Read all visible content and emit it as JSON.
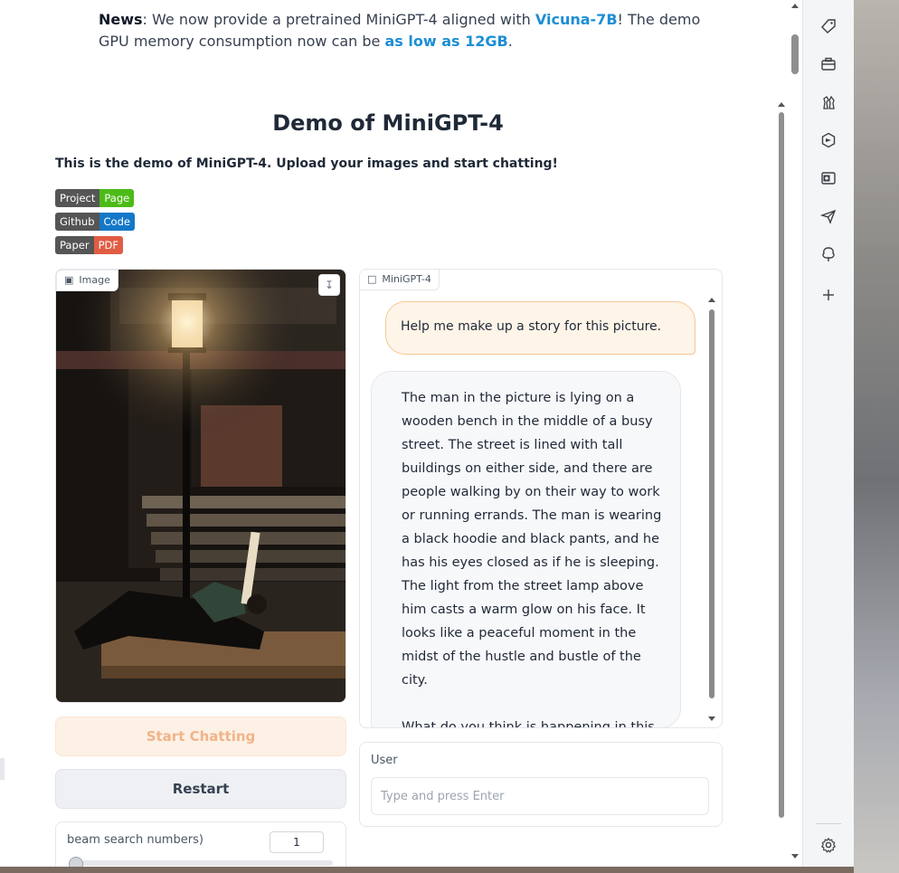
{
  "news": {
    "label": "News",
    "part1": ": We now provide a pretrained MiniGPT-4 aligned with ",
    "link1": "Vicuna-7B",
    "part2": "! The demo GPU memory consumption now can be ",
    "link2": "as low as 12GB",
    "part3": "."
  },
  "title": "Demo of MiniGPT-4",
  "subtitle": "This is the demo of MiniGPT-4. Upload your images and start chatting!",
  "badges": [
    {
      "left": "Project",
      "right": "Page"
    },
    {
      "left": "Github",
      "right": "Code"
    },
    {
      "left": "Paper",
      "right": "PDF"
    }
  ],
  "image_panel": {
    "label": "Image"
  },
  "buttons": {
    "start": "Start Chatting",
    "restart": "Restart"
  },
  "beam": {
    "label": "beam search numbers)",
    "value": "1"
  },
  "chat": {
    "label": "MiniGPT-4",
    "user_message": "Help me make up a story for this picture.",
    "bot_paragraph1": "The man in the picture is lying on a wooden bench in the middle of a busy street. The street is lined with tall buildings on either side, and there are people walking by on their way to work or running errands. The man is wearing a black hoodie and black pants, and he has his eyes closed as if he is sleeping. The light from the street lamp above him casts a warm glow on his face. It looks like a peaceful moment in the midst of the hustle and bustle of the city.",
    "bot_paragraph2": "What do you think is happening in this picture?"
  },
  "user_input": {
    "label": "User",
    "placeholder": "Type and press Enter",
    "value": ""
  },
  "sidebar_icons": [
    "tag-icon",
    "briefcase-icon",
    "chess-icon",
    "copilot-icon",
    "outlook-icon",
    "send-icon",
    "tree-icon",
    "add-icon",
    "settings-icon"
  ]
}
